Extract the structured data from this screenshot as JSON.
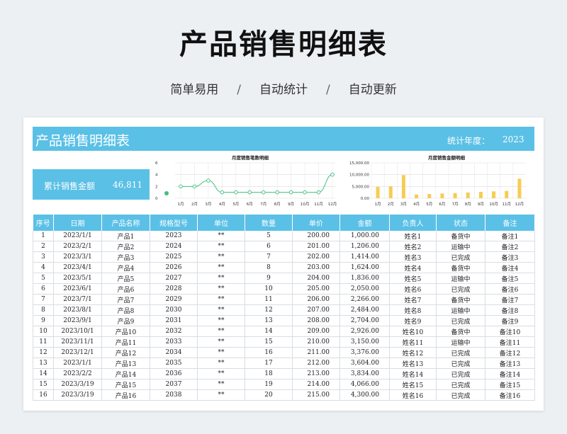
{
  "title": "产品销售明细表",
  "subtitle": {
    "items": [
      "简单易用",
      "自动统计",
      "自动更新"
    ],
    "separator": "/"
  },
  "sheet": {
    "banner_title": "产品销售明细表",
    "year_label": "统计年度：",
    "year": "2023",
    "kpi_label": "累计销售金额",
    "kpi_value": "46,811"
  },
  "chart_data": [
    {
      "type": "line",
      "title": "月度销售笔数明细",
      "categories": [
        "1月",
        "2月",
        "3月",
        "4月",
        "5月",
        "6月",
        "7月",
        "8月",
        "9月",
        "10月",
        "11月",
        "12月"
      ],
      "values": [
        2,
        2,
        3,
        1,
        1,
        1,
        1,
        1,
        1,
        1,
        1,
        4
      ],
      "ylim": [
        0,
        6
      ],
      "yticks": [
        "0",
        "2",
        "4",
        "6"
      ],
      "color": "#3fbf7f",
      "grid": true
    },
    {
      "type": "bar",
      "title": "月度销售金额明细",
      "categories": [
        "1月",
        "2月",
        "3月",
        "4月",
        "5月",
        "6月",
        "7月",
        "8月",
        "9月",
        "10月",
        "11月",
        "12月"
      ],
      "values": [
        4800,
        5000,
        9800,
        1600,
        1800,
        2000,
        2200,
        2450,
        2700,
        2900,
        3100,
        8300
      ],
      "ylim": [
        0,
        15000
      ],
      "yticks": [
        "0.00",
        "5,000.00",
        "10,000.00",
        "15,000.00"
      ],
      "color": "#f7cc53",
      "grid": true
    }
  ],
  "table": {
    "headers": [
      "序号",
      "日期",
      "产品名称",
      "规格型号",
      "单位",
      "数量",
      "单价",
      "金额",
      "负责人",
      "状态",
      "备注"
    ],
    "rows": [
      [
        "1",
        "2023/1/1",
        "产品1",
        "2023",
        "**",
        "5",
        "200.00",
        "1,000.00",
        "姓名1",
        "备货中",
        "备注1"
      ],
      [
        "2",
        "2023/2/1",
        "产品2",
        "2024",
        "**",
        "6",
        "201.00",
        "1,206.00",
        "姓名2",
        "运输中",
        "备注2"
      ],
      [
        "3",
        "2023/3/1",
        "产品3",
        "2025",
        "**",
        "7",
        "202.00",
        "1,414.00",
        "姓名3",
        "已完成",
        "备注3"
      ],
      [
        "4",
        "2023/4/1",
        "产品4",
        "2026",
        "**",
        "8",
        "203.00",
        "1,624.00",
        "姓名4",
        "备货中",
        "备注4"
      ],
      [
        "5",
        "2023/5/1",
        "产品5",
        "2027",
        "**",
        "9",
        "204.00",
        "1,836.00",
        "姓名5",
        "运输中",
        "备注5"
      ],
      [
        "6",
        "2023/6/1",
        "产品6",
        "2028",
        "**",
        "10",
        "205.00",
        "2,050.00",
        "姓名6",
        "已完成",
        "备注6"
      ],
      [
        "7",
        "2023/7/1",
        "产品7",
        "2029",
        "**",
        "11",
        "206.00",
        "2,266.00",
        "姓名7",
        "备货中",
        "备注7"
      ],
      [
        "8",
        "2023/8/1",
        "产品8",
        "2030",
        "**",
        "12",
        "207.00",
        "2,484.00",
        "姓名8",
        "运输中",
        "备注8"
      ],
      [
        "9",
        "2023/9/1",
        "产品9",
        "2031",
        "**",
        "13",
        "208.00",
        "2,704.00",
        "姓名9",
        "已完成",
        "备注9"
      ],
      [
        "10",
        "2023/10/1",
        "产品10",
        "2032",
        "**",
        "14",
        "209.00",
        "2,926.00",
        "姓名10",
        "备货中",
        "备注10"
      ],
      [
        "11",
        "2023/11/1",
        "产品11",
        "2033",
        "**",
        "15",
        "210.00",
        "3,150.00",
        "姓名11",
        "运输中",
        "备注11"
      ],
      [
        "12",
        "2023/12/1",
        "产品12",
        "2034",
        "**",
        "16",
        "211.00",
        "3,376.00",
        "姓名12",
        "已完成",
        "备注12"
      ],
      [
        "13",
        "2023/1/1",
        "产品13",
        "2035",
        "**",
        "17",
        "212.00",
        "3,604.00",
        "姓名13",
        "已完成",
        "备注13"
      ],
      [
        "14",
        "2023/2/2",
        "产品14",
        "2036",
        "**",
        "18",
        "213.00",
        "3,834.00",
        "姓名14",
        "已完成",
        "备注14"
      ],
      [
        "15",
        "2023/3/19",
        "产品15",
        "2037",
        "**",
        "19",
        "214.00",
        "4,066.00",
        "姓名15",
        "已完成",
        "备注15"
      ],
      [
        "16",
        "2023/3/19",
        "产品16",
        "2038",
        "**",
        "20",
        "215.00",
        "4,300.00",
        "姓名16",
        "已完成",
        "备注16"
      ]
    ]
  }
}
